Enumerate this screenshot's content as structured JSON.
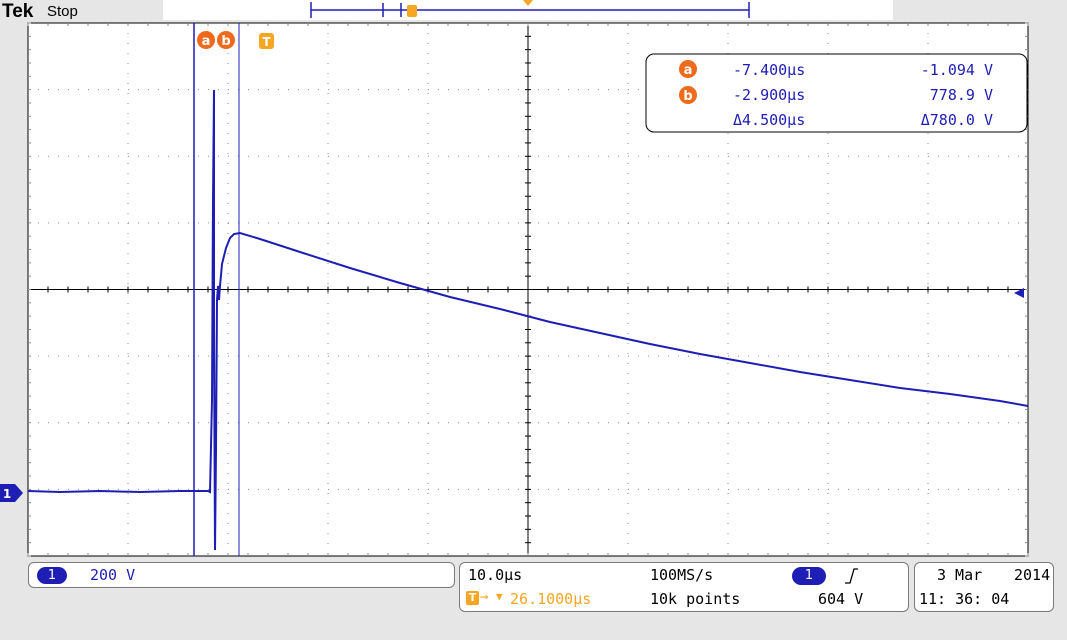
{
  "header": {
    "brand": "Tek",
    "run_state": "Stop"
  },
  "colors": {
    "trace": "#1e1eb4",
    "orange": "#f5a623",
    "cursor_badge": "#f06a1e",
    "grid": "#8c8c8c",
    "bezel": "#e6e6e6",
    "text_blue": "#1e1eb4"
  },
  "markers": {
    "cursor_a_label": "a",
    "cursor_b_label": "b",
    "trigger_label": "T",
    "channel_label": "1"
  },
  "cursor_readout": {
    "a_time": "-7.400µs",
    "a_value": "-1.094 V",
    "b_time": "-2.900µs",
    "b_value": "778.9 V",
    "delta_time": "Δ4.500µs",
    "delta_value": "Δ780.0 V"
  },
  "channel": {
    "number": "1",
    "scale": "200 V"
  },
  "timebase": {
    "scale": "10.0µs",
    "trigger_position": "26.1000µs",
    "sample_rate": "100MS/s",
    "record_length": "10k points"
  },
  "trigger": {
    "source": "1",
    "slope_icon": "rising-edge-icon",
    "level": "604 V"
  },
  "datetime": {
    "date_day": "3 Mar",
    "year": "2014",
    "time": "11: 36: 04"
  }
}
